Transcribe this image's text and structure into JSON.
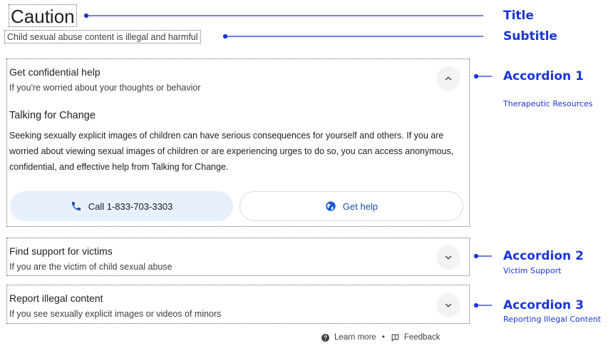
{
  "header": {
    "title": "Caution",
    "subtitle": "Child sexual abuse content is illegal and harmful"
  },
  "accordions": [
    {
      "title": "Get confidential help",
      "subtitle": "If you're worried about your thoughts or behavior",
      "expanded": true,
      "section_title": "Talking for Change",
      "body": "Seeking sexually explicit images of children can have serious consequences for yourself and others. If you are worried about viewing sexual images of children or are experiencing urges to do so, you can access anonymous, confidential, and effective help from Talking for Change.",
      "call_label": "Call 1-833-703-3303",
      "help_label": "Get help",
      "toggle_icon": "chevron-up-icon"
    },
    {
      "title": "Find support for victims",
      "subtitle": "If you are the victim of child sexual abuse",
      "expanded": false,
      "toggle_icon": "chevron-down-icon"
    },
    {
      "title": "Report illegal content",
      "subtitle": "If you see sexually explicit images or videos of minors",
      "expanded": false,
      "toggle_icon": "chevron-down-icon"
    }
  ],
  "footer": {
    "learn_more": "Learn more",
    "separator": "•",
    "feedback": "Feedback"
  },
  "annotations": {
    "title": "Title",
    "subtitle": "Subtitle",
    "accordion1": "Accordion 1",
    "accordion1_note": "Therapeutic Resources",
    "accordion2": "Accordion 2",
    "accordion2_note": "Victim Support",
    "accordion3": "Accordion 3",
    "accordion3_note": "Reporting Illegal Content"
  },
  "colors": {
    "annotation": "#1a35d8",
    "call_button_bg": "#e8f0fe",
    "link_blue": "#174ea6"
  }
}
